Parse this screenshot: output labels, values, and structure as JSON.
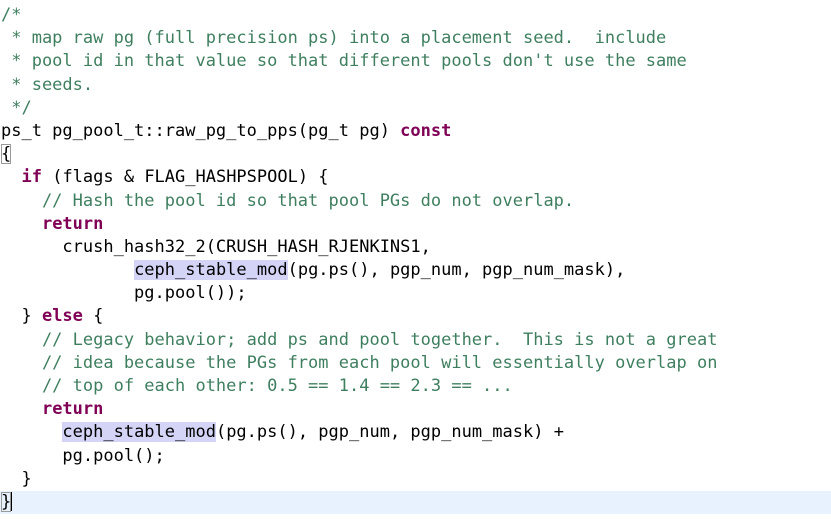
{
  "editor": {
    "name": "code-editor",
    "lines": [
      [
        {
          "t": "comment",
          "v": "/*"
        }
      ],
      [
        {
          "t": "comment",
          "v": " * map raw pg (full precision ps) into a placement seed.  include"
        }
      ],
      [
        {
          "t": "comment",
          "v": " * pool id in that value so that different pools don't use the same"
        }
      ],
      [
        {
          "t": "comment",
          "v": " * seeds."
        }
      ],
      [
        {
          "t": "comment",
          "v": " */"
        }
      ],
      [
        {
          "t": "plain",
          "v": "ps_t pg_pool_t::raw_pg_to_pps(pg_t pg) "
        },
        {
          "t": "keyword",
          "v": "const"
        }
      ],
      [
        {
          "t": "bracket",
          "v": "{"
        }
      ],
      [
        {
          "t": "plain",
          "v": "  "
        },
        {
          "t": "keyword",
          "v": "if"
        },
        {
          "t": "plain",
          "v": " (flags & FLAG_HASHPSPOOL) {"
        }
      ],
      [
        {
          "t": "comment",
          "v": "    // Hash the pool id so that pool PGs do not overlap."
        }
      ],
      [
        {
          "t": "plain",
          "v": "    "
        },
        {
          "t": "keyword",
          "v": "return"
        }
      ],
      [
        {
          "t": "plain",
          "v": "      crush_hash32_2(CRUSH_HASH_RJENKINS1,"
        }
      ],
      [
        {
          "t": "plain",
          "v": "             "
        },
        {
          "t": "highlight",
          "v": "ceph_stable_mod"
        },
        {
          "t": "plain",
          "v": "(pg.ps(), pgp_num, pgp_num_mask),"
        }
      ],
      [
        {
          "t": "plain",
          "v": "             pg.pool());"
        }
      ],
      [
        {
          "t": "plain",
          "v": "  } "
        },
        {
          "t": "keyword",
          "v": "else"
        },
        {
          "t": "plain",
          "v": " {"
        }
      ],
      [
        {
          "t": "comment",
          "v": "    // Legacy behavior; add ps and pool together.  This is not a great"
        }
      ],
      [
        {
          "t": "comment",
          "v": "    // idea because the PGs from each pool will essentially overlap on"
        }
      ],
      [
        {
          "t": "comment",
          "v": "    // top of each other: 0.5 == 1.4 == 2.3 == ..."
        }
      ],
      [
        {
          "t": "plain",
          "v": "    "
        },
        {
          "t": "keyword",
          "v": "return"
        }
      ],
      [
        {
          "t": "plain",
          "v": "      "
        },
        {
          "t": "highlight",
          "v": "ceph_stable_mod"
        },
        {
          "t": "plain",
          "v": "(pg.ps(), pgp_num, pgp_num_mask) +"
        }
      ],
      [
        {
          "t": "plain",
          "v": "      pg.pool();"
        }
      ],
      [
        {
          "t": "plain",
          "v": "  }"
        }
      ],
      [
        {
          "t": "bracket",
          "v": "}"
        },
        {
          "t": "caret",
          "v": ""
        }
      ]
    ],
    "current_line_index": 21,
    "colors": {
      "comment": "#3f7f5f",
      "keyword": "#7f0055",
      "occurrence_highlight": "#d4d4f7",
      "current_line": "#e8f2fe"
    }
  }
}
